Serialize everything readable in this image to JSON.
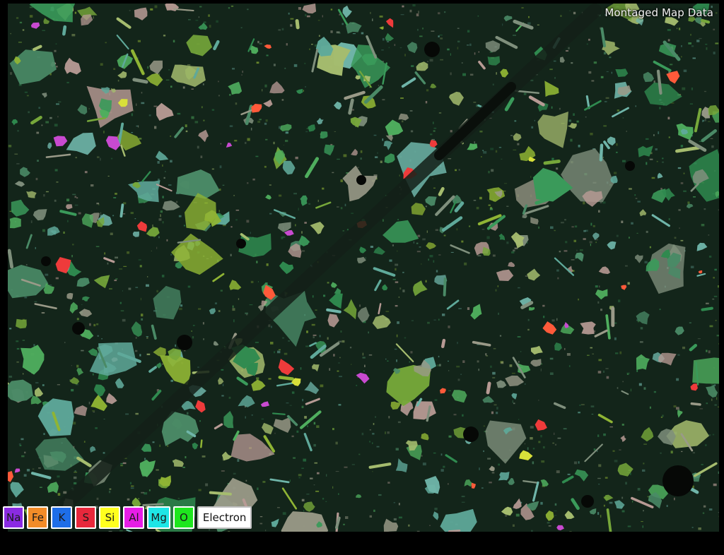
{
  "map": {
    "title": "Montaged Map Data"
  },
  "legend": {
    "elements": [
      {
        "symbol": "Na",
        "color": "#8a2be2"
      },
      {
        "symbol": "Fe",
        "color": "#f28c28"
      },
      {
        "symbol": "K",
        "color": "#1e6ee8"
      },
      {
        "symbol": "S",
        "color": "#e8283c"
      },
      {
        "symbol": "Si",
        "color": "#ffff1e"
      },
      {
        "symbol": "Al",
        "color": "#e61ee6"
      },
      {
        "symbol": "Mg",
        "color": "#1ee6e6"
      },
      {
        "symbol": "O",
        "color": "#1ee61e"
      }
    ],
    "electron_label": "Electron"
  },
  "palette": {
    "matrix": "#13251a",
    "particle_colors": [
      "#2f8a4f",
      "#4fae5e",
      "#76a73a",
      "#8fb434",
      "#5fa99a",
      "#6fb5a9",
      "#9a9a88",
      "#b79a94",
      "#4a8a66",
      "#3a9a5a",
      "#a5bc6e",
      "#7f8f7c"
    ],
    "highlight_colors": [
      "#ee3b3b",
      "#ff5a3a",
      "#d8e03a",
      "#c84ad0"
    ]
  }
}
